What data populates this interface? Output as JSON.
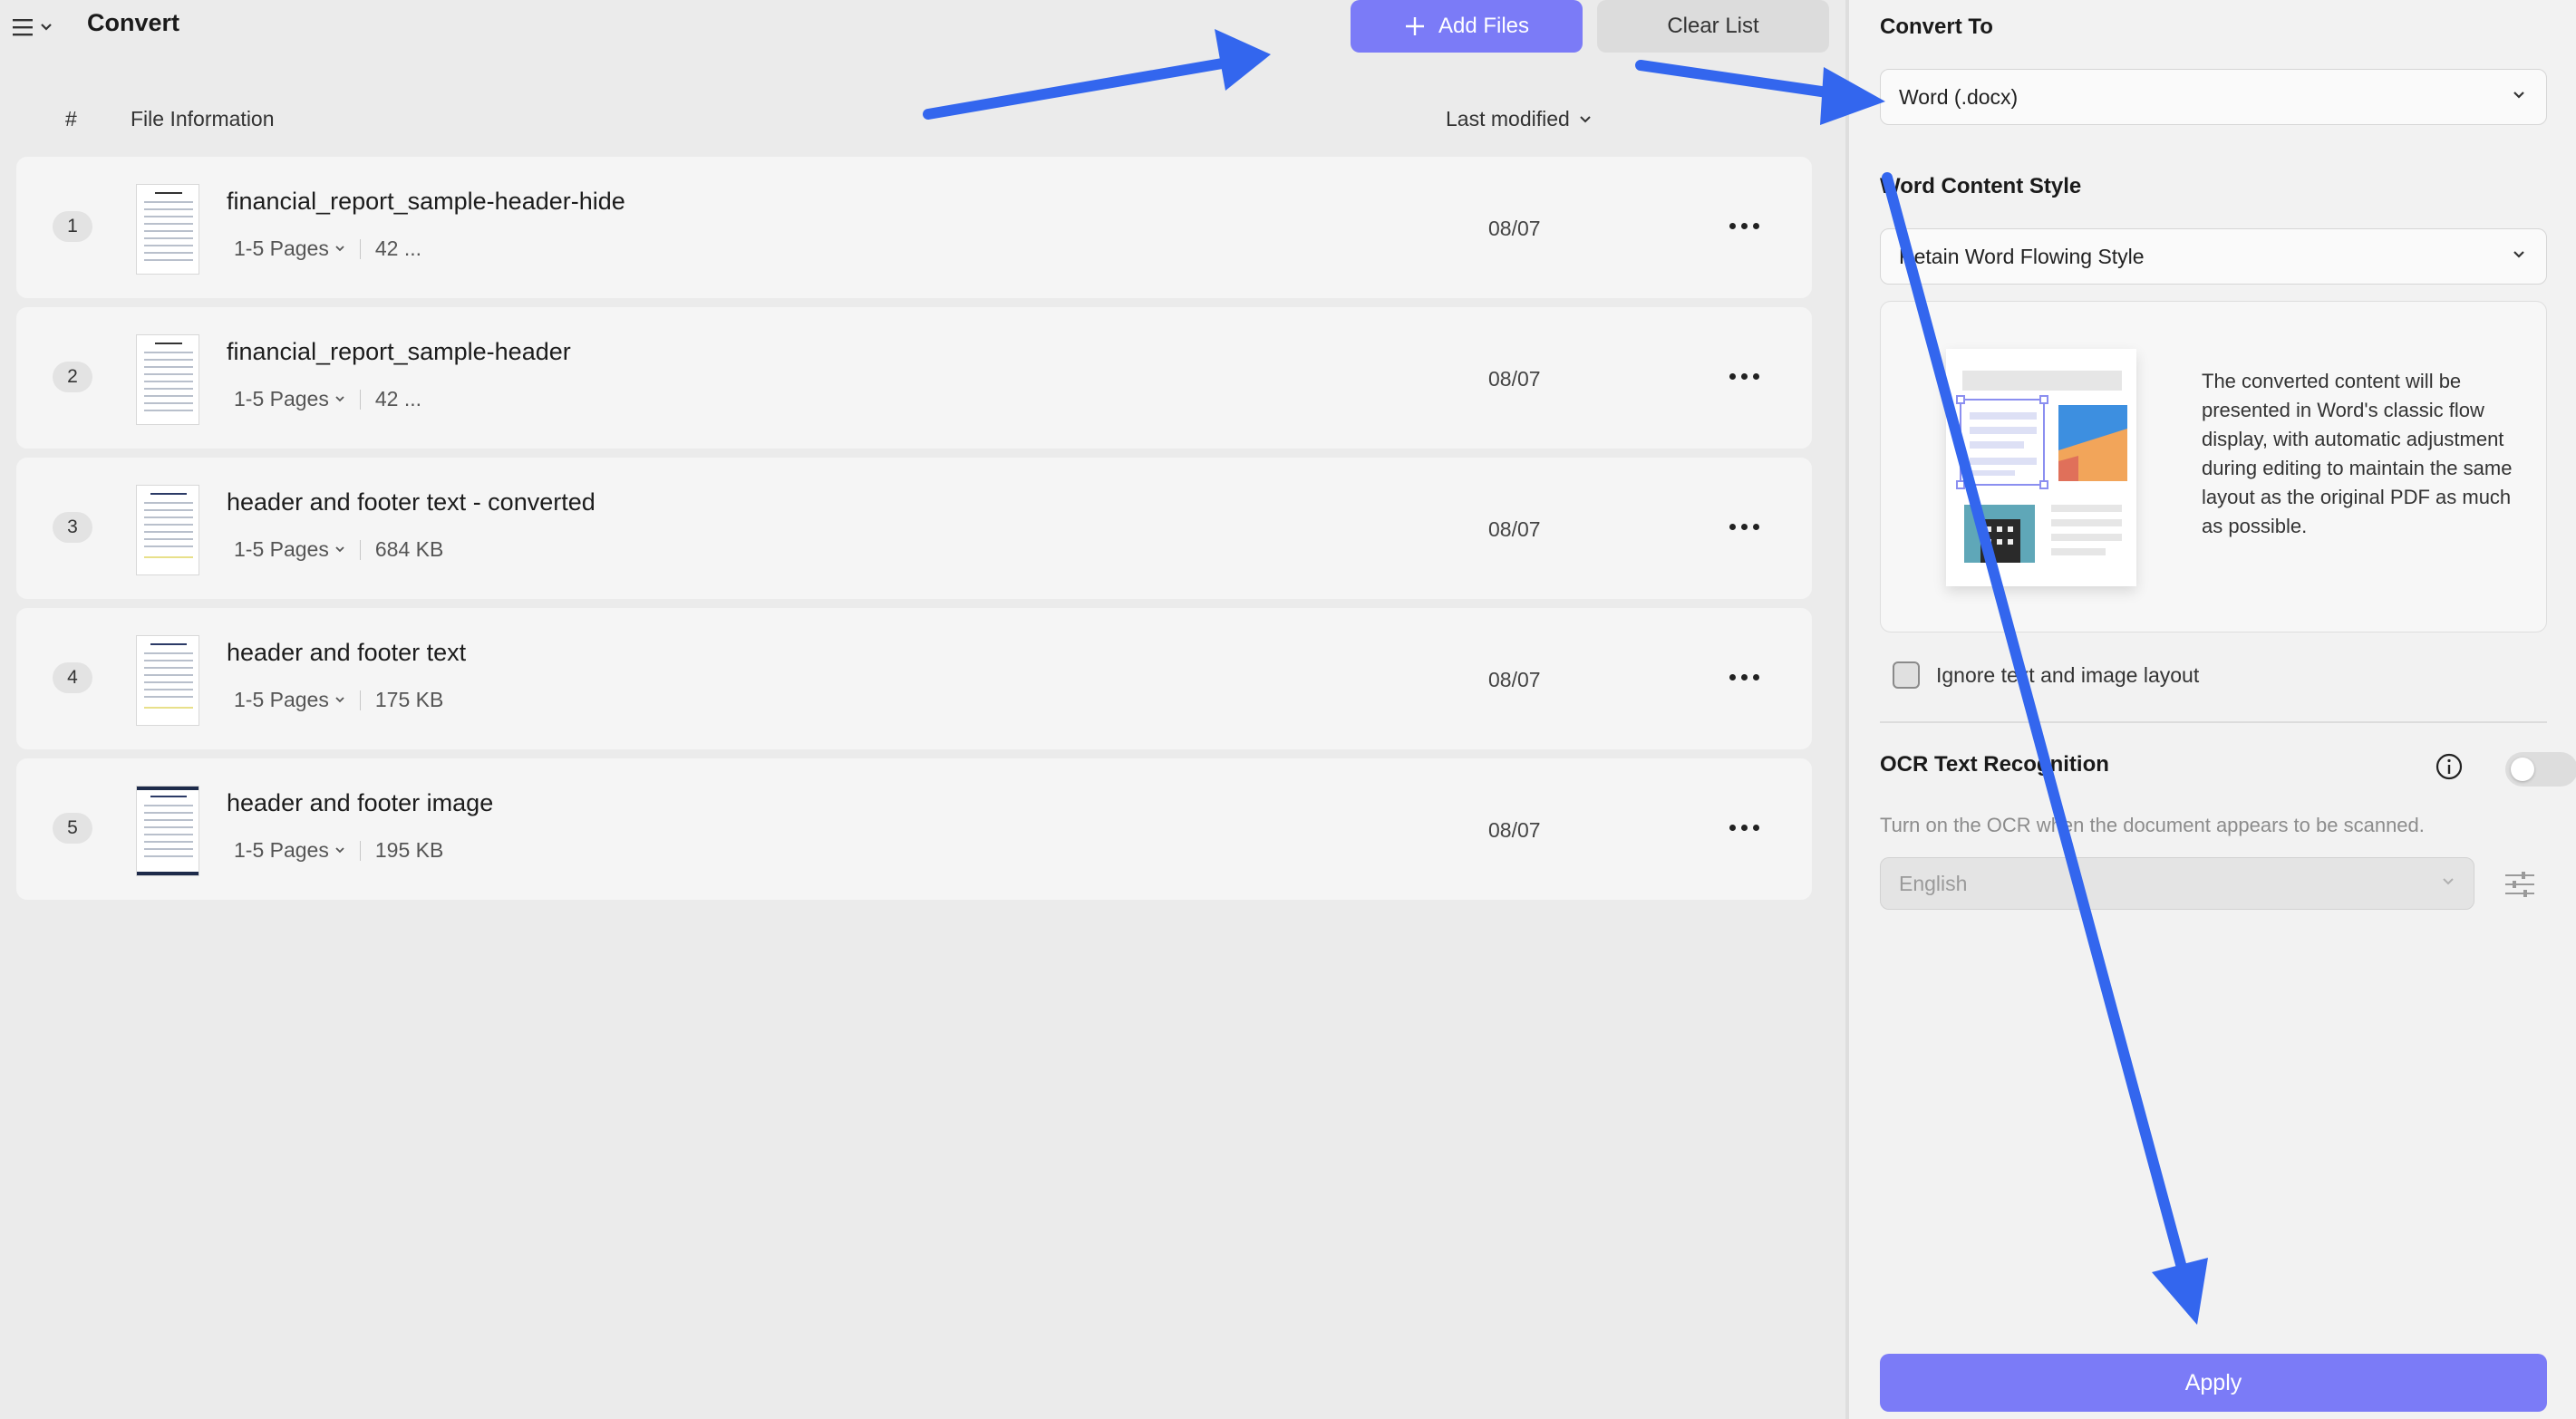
{
  "header": {
    "title": "Convert",
    "add_files_label": "Add Files",
    "clear_list_label": "Clear List"
  },
  "columns": {
    "hash": "#",
    "file_info": "File Information",
    "last_modified": "Last modified"
  },
  "files": [
    {
      "num": "1",
      "name": "financial_report_sample-header-hide",
      "pages": "1-5 Pages",
      "size": "42 ...",
      "date": "08/07"
    },
    {
      "num": "2",
      "name": "financial_report_sample-header",
      "pages": "1-5 Pages",
      "size": "42 ...",
      "date": "08/07"
    },
    {
      "num": "3",
      "name": "header and footer text - converted",
      "pages": "1-5 Pages",
      "size": "684 KB",
      "date": "08/07"
    },
    {
      "num": "4",
      "name": "header and footer text",
      "pages": "1-5 Pages",
      "size": "175 KB",
      "date": "08/07"
    },
    {
      "num": "5",
      "name": "header and footer image",
      "pages": "1-5 Pages",
      "size": "195 KB",
      "date": "08/07"
    }
  ],
  "panel": {
    "convert_to_title": "Convert To",
    "convert_to_value": "Word (.docx)",
    "content_style_title": "Word Content Style",
    "content_style_value": "Retain Word Flowing Style",
    "preview_description": "The converted content will be presented in Word's classic flow display, with automatic adjustment during editing to maintain the same layout as the original PDF as much as possible.",
    "ignore_layout_label": "Ignore text and image layout",
    "ignore_layout_checked": false,
    "ocr_title": "OCR Text Recognition",
    "ocr_enabled": false,
    "ocr_description": "Turn on the OCR when the document appears to be scanned.",
    "ocr_language": "English",
    "apply_label": "Apply"
  },
  "colors": {
    "accent": "#7b7bf7",
    "annotation_arrow": "#3366ee"
  },
  "icons": [
    "hamburger-menu-icon",
    "chevron-down-icon",
    "plus-icon",
    "more-dots-icon",
    "info-icon",
    "sliders-icon"
  ]
}
